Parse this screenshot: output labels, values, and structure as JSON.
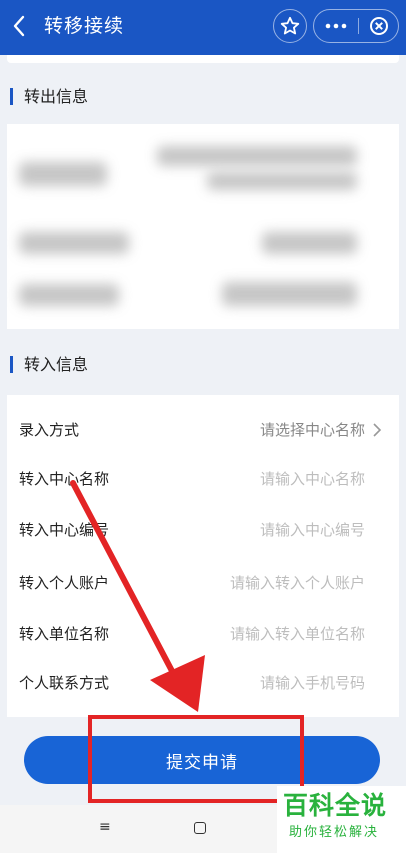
{
  "header": {
    "title": "转移接续",
    "color": "#1a56c4",
    "icons": [
      "back-arrow-icon",
      "star-icon",
      "more-dots-icon",
      "close-circle-icon"
    ]
  },
  "transfer_out": {
    "title": "转出信息"
  },
  "transfer_in": {
    "title": "转入信息",
    "rows": [
      {
        "label": "录入方式",
        "value": "请选择中心名称"
      },
      {
        "label": "转入中心名称",
        "value": "请输入中心名称"
      },
      {
        "label": "转入中心编号",
        "value": "请输入中心编号"
      },
      {
        "label": "转入个人账户",
        "value": "请输入转入个人账户"
      },
      {
        "label": "转入单位名称",
        "value": "请输入转入单位名称"
      },
      {
        "label": "个人联系方式",
        "value": "请输入手机号码"
      }
    ]
  },
  "submit": {
    "label": "提交申请",
    "color": "#1864d6"
  },
  "navbar": {
    "menu_icon": "≡"
  },
  "watermark": {
    "title": "百科全说",
    "subtitle": "助你轻松解决"
  },
  "annotation_color": "#e32425"
}
